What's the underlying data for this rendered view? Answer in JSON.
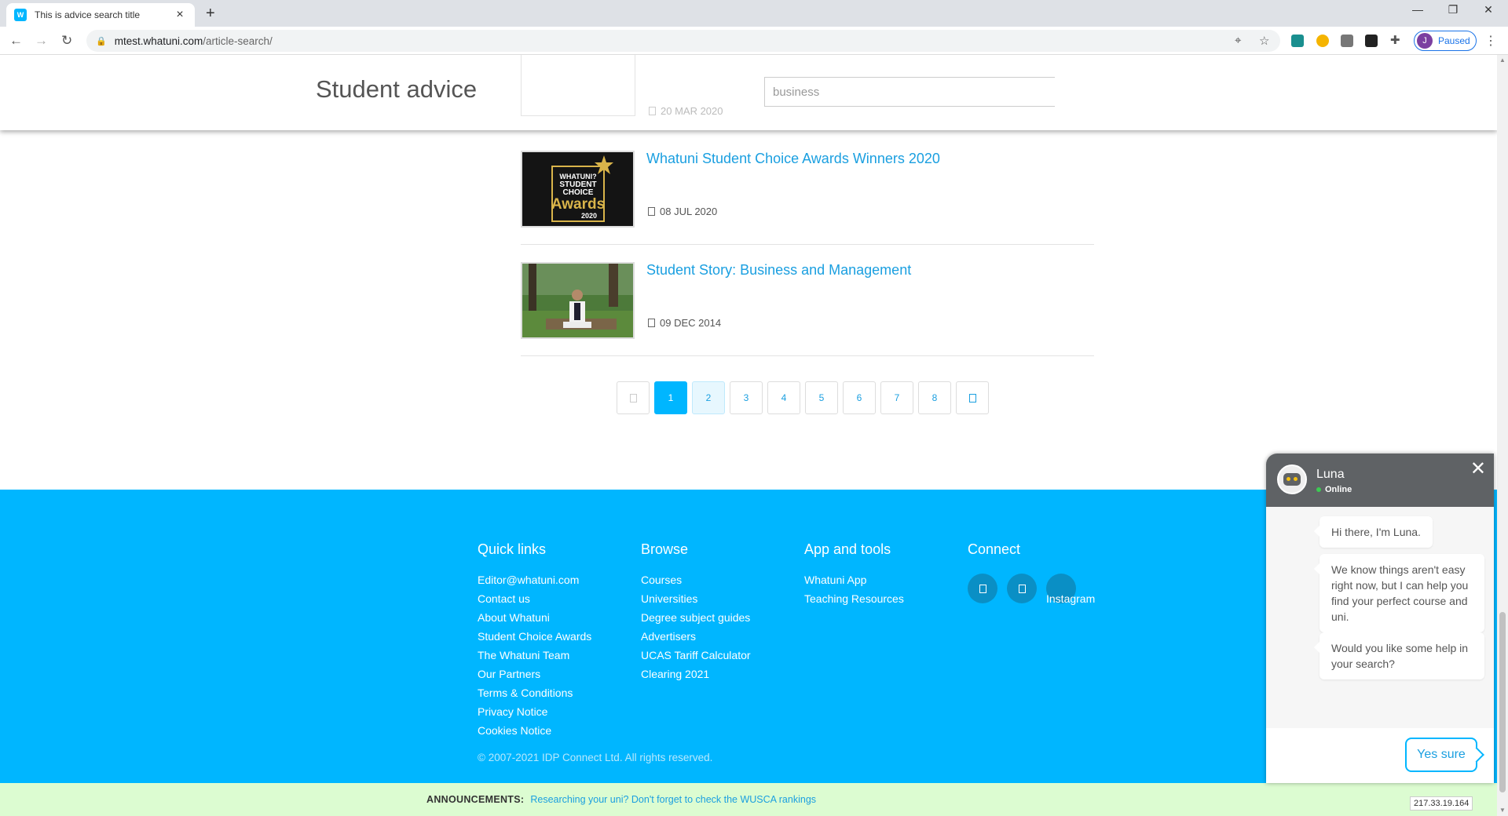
{
  "browser": {
    "tab_title": "This is advice search title",
    "url_host": "mtest.whatuni.com",
    "url_path": "/article-search/",
    "profile_initial": "J",
    "profile_status": "Paused"
  },
  "header": {
    "title": "Student advice",
    "search_value": "business",
    "partial_article_date": "20 MAR 2020"
  },
  "articles": [
    {
      "title": "Whatuni Student Choice Awards Winners 2020",
      "date": "08 JUL 2020",
      "thumb_text": [
        "WHATUNI?",
        "STUDENT",
        "CHOICE",
        "Awards",
        "2020"
      ]
    },
    {
      "title": "Student Story: Business and Management",
      "date": "09 DEC 2014"
    }
  ],
  "pagination": {
    "pages": [
      "1",
      "2",
      "3",
      "4",
      "5",
      "6",
      "7",
      "8"
    ],
    "active": "1"
  },
  "footer": {
    "quick_links": {
      "heading": "Quick links",
      "items": [
        "Editor@whatuni.com",
        "Contact us",
        "About Whatuni",
        "Student Choice Awards",
        "The Whatuni Team",
        "Our Partners",
        "Terms & Conditions",
        "Privacy Notice",
        "Cookies Notice"
      ]
    },
    "browse": {
      "heading": "Browse",
      "items": [
        "Courses",
        "Universities",
        "Degree subject guides",
        "Advertisers",
        "UCAS Tariff Calculator",
        "Clearing 2021"
      ]
    },
    "app_tools": {
      "heading": "App and tools",
      "items": [
        "Whatuni App",
        "Teaching Resources"
      ]
    },
    "connect": {
      "heading": "Connect",
      "instagram_label": "Instagram"
    },
    "copyright": "© 2007-2021 IDP Connect Ltd. All rights reserved."
  },
  "announcement": {
    "label": "ANNOUNCEMENTS:",
    "text": "Researching your uni? Don't forget to check the WUSCA rankings"
  },
  "chat": {
    "bot_name": "Luna",
    "status": "Online",
    "messages": [
      "Hi there, I'm Luna.",
      "We know things aren't easy right now, but I can help you find your perfect course and uni.",
      "Would you like some help in your search?"
    ],
    "reply_button": "Yes sure"
  },
  "ip_address": "217.33.19.164",
  "colors": {
    "brand": "#00b6ff",
    "link": "#1a9fe0",
    "announcement_bg": "#dcfcd1",
    "chat_header": "#5f6265"
  }
}
